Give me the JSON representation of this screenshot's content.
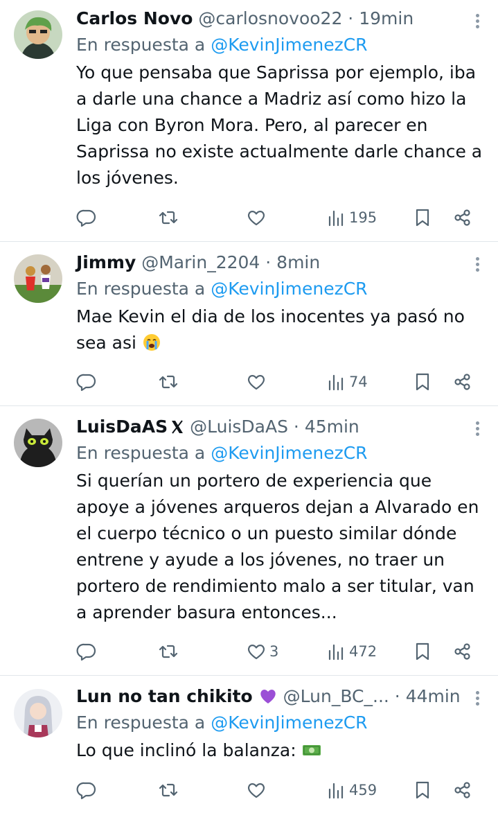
{
  "tweets": [
    {
      "name": "Carlos Novo",
      "handle": "@carlosnovoo22",
      "dot": " · ",
      "time": "19min",
      "reply_prefix": "En respuesta a ",
      "reply_mention": "@KevinJimenezCR",
      "text": "Yo que pensaba que Saprissa por ejemplo, iba a darle una chance a Madriz así como hizo la Liga con Byron Mora. Pero, al parecer en Saprissa no existe actualmente darle chance a los jóvenes.",
      "likes": "",
      "views": "195"
    },
    {
      "name": "Jimmy",
      "handle": "@Marin_2204",
      "dot": " · ",
      "time": "8min",
      "reply_prefix": "En respuesta a ",
      "reply_mention": "@KevinJimenezCR",
      "text": "Mae Kevin el dia de los inocentes ya pasó no sea asi",
      "likes": "",
      "views": "74"
    },
    {
      "name": "LuisDaAS",
      "handle": "@LuisDaAS",
      "dot": " · ",
      "time": "45min",
      "reply_prefix": "En respuesta a ",
      "reply_mention": "@KevinJimenezCR",
      "text": "Si querían un portero de experiencia que apoye a jóvenes arqueros dejan a Alvarado en el cuerpo técnico o un puesto similar dónde entrene y ayude a los jóvenes, no traer un portero de rendimiento malo a ser titular, van a aprender basura entonces...",
      "likes": "3",
      "views": "472"
    },
    {
      "name": "Lun no tan chikito",
      "handle": "@Lun_BC_...",
      "dot": " · ",
      "time": "44min",
      "reply_prefix": "En respuesta a ",
      "reply_mention": "@KevinJimenezCR",
      "text": "Lo que inclinó la balanza:",
      "likes": "",
      "views": "459"
    }
  ],
  "colors": {
    "text": "#0f1419",
    "secondary": "#536471",
    "link": "#1d9bf0",
    "divider": "#e1e6ea"
  },
  "icons": [
    "reply-icon",
    "retweet-icon",
    "like-icon",
    "views-icon",
    "bookmark-icon",
    "share-icon",
    "more-icon"
  ]
}
